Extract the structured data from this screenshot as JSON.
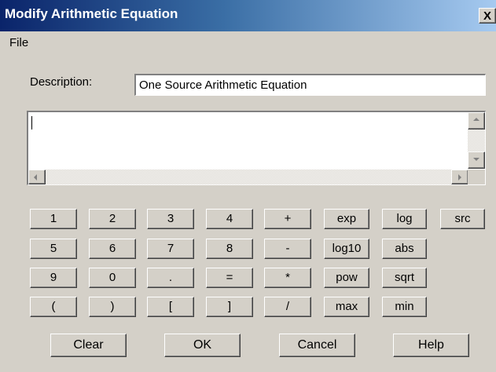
{
  "window": {
    "title": "Modify Arithmetic Equation",
    "close_label": "X"
  },
  "menu": {
    "file": "File"
  },
  "description": {
    "label": "Description:",
    "value": "One Source Arithmetic Equation"
  },
  "equation": {
    "value": ""
  },
  "keypad": {
    "row1": [
      "1",
      "2",
      "3",
      "4",
      "+",
      "exp",
      "log",
      "src"
    ],
    "row2": [
      "5",
      "6",
      "7",
      "8",
      "-",
      "log10",
      "abs"
    ],
    "row3": [
      "9",
      "0",
      ".",
      "=",
      "*",
      "pow",
      "sqrt"
    ],
    "row4": [
      "(",
      ")",
      "[",
      "]",
      "/",
      "max",
      "min"
    ]
  },
  "buttons": {
    "clear": "Clear",
    "ok": "OK",
    "cancel": "Cancel",
    "help": "Help"
  },
  "icons": [
    "close-icon",
    "scroll-up-icon",
    "scroll-down-icon",
    "scroll-left-icon",
    "scroll-right-icon"
  ],
  "colors": {
    "titlebar_start": "#0a246a",
    "titlebar_end": "#a6caf0",
    "dialog_bg": "#d4d0c8"
  }
}
